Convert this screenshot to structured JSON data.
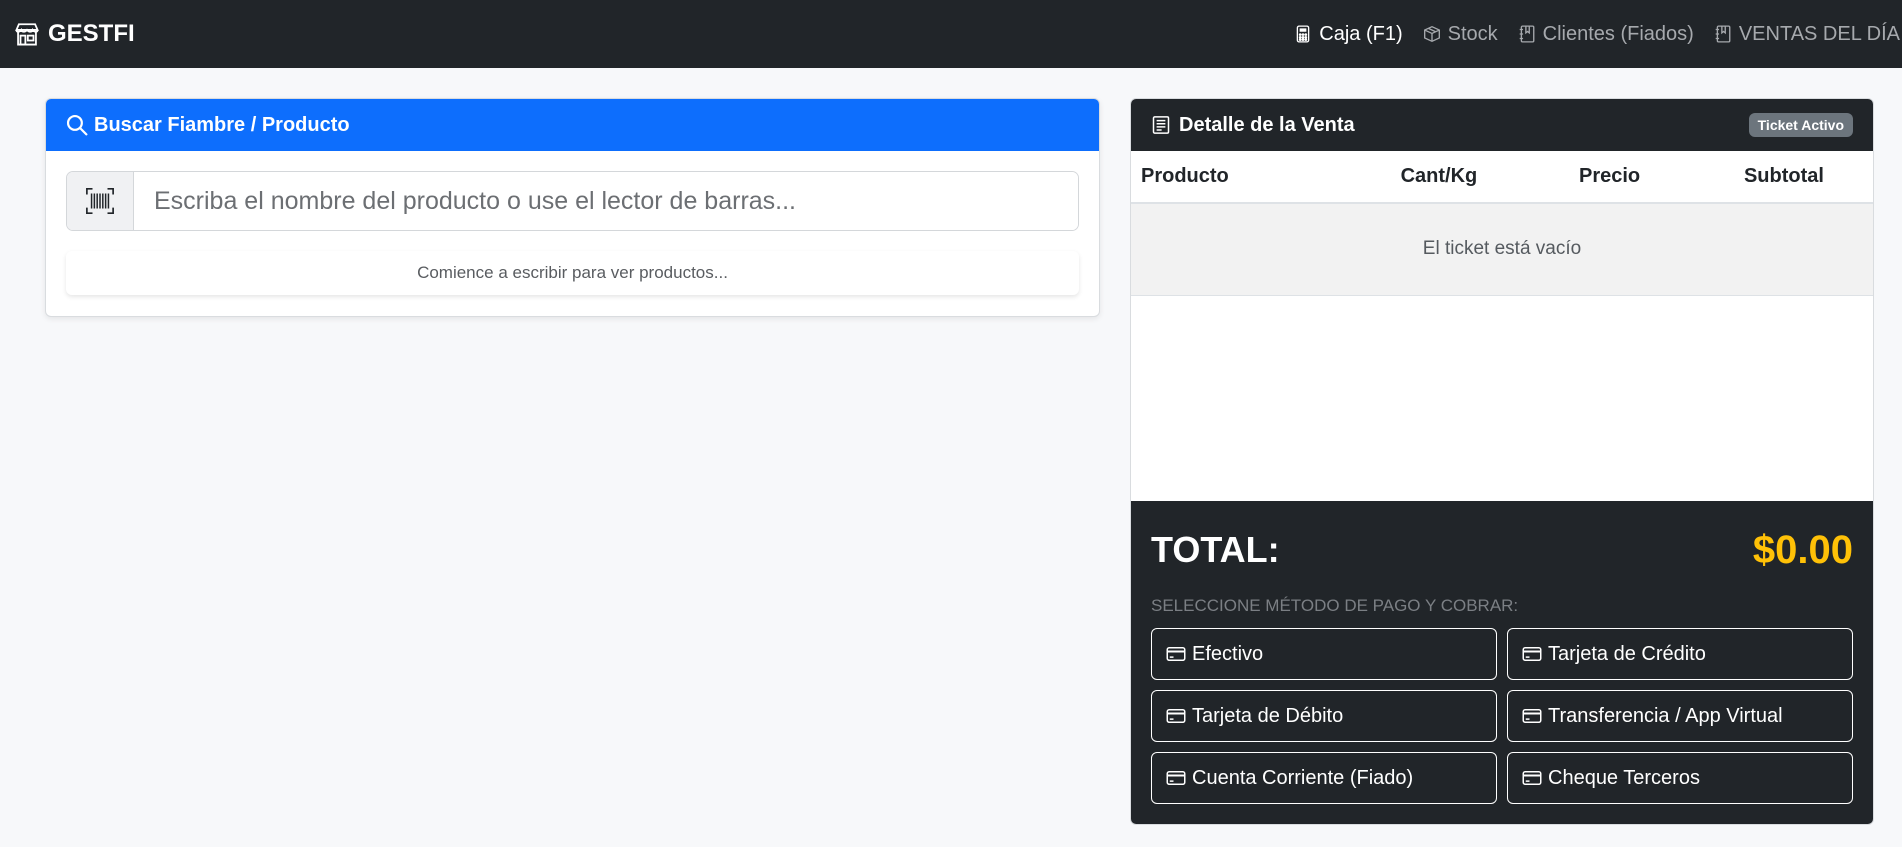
{
  "navbar": {
    "brand": "GESTFI",
    "brand_icon": "shop-icon",
    "links": [
      {
        "label": "Caja (F1)",
        "icon": "calculator-icon",
        "active": true
      },
      {
        "label": "Stock",
        "icon": "box-icon",
        "active": false
      },
      {
        "label": "Clientes (Fiados)",
        "icon": "journal-icon",
        "active": false
      },
      {
        "label": "VENTAS DEL DÍA",
        "icon": "journal-icon",
        "active": false
      }
    ]
  },
  "search_card": {
    "title": "Buscar Fiambre / Producto",
    "search_placeholder": "Escriba el nombre del producto o use el lector de barras...",
    "search_value": "",
    "hint": "Comience a escribir para ver productos..."
  },
  "sale_card": {
    "title": "Detalle de la Venta",
    "badge": "Ticket Activo",
    "columns": [
      "Producto",
      "Cant/Kg",
      "Precio",
      "Subtotal"
    ],
    "empty_message": "El ticket está vacío",
    "total_label": "TOTAL:",
    "total_value": "$0.00",
    "payment_title": "SELECCIONE MÉTODO DE PAGO Y COBRAR:",
    "payment_methods": [
      "Efectivo",
      "Tarjeta de Crédito",
      "Tarjeta de Débito",
      "Transferencia / App Virtual",
      "Cuenta Corriente (Fiado)",
      "Cheque Terceros"
    ]
  },
  "colors": {
    "navbar_bg": "#212529",
    "primary": "#0d6efd",
    "total_accent": "#ffc107",
    "badge": "#6c757d"
  }
}
